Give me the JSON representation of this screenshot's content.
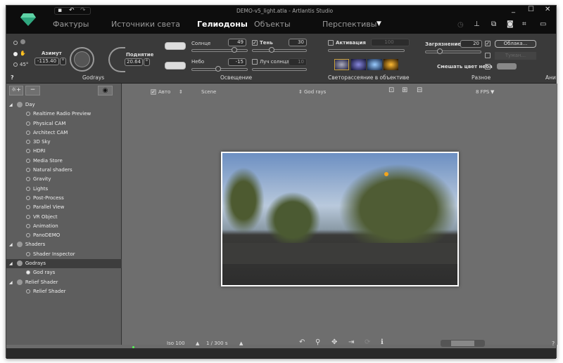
{
  "window": {
    "title": "DEMO-v5_light.atla - Artlantis Studio",
    "minimize": "_",
    "maximize": "☐",
    "close": "✕"
  },
  "tabs": [
    {
      "label": "Фактуры"
    },
    {
      "label": "Источники света"
    },
    {
      "label": "Гелиодоны"
    },
    {
      "label": "Объекты"
    },
    {
      "label": "Перспективы"
    }
  ],
  "tabs_dropdown": "▼",
  "ribbon": {
    "godrays": {
      "group": "Godrays",
      "azimuth_label": "Азимут",
      "azimuth_value": "-115.40",
      "elevation_label": "Поднятие",
      "elevation_value": "20.64",
      "deg": "°",
      "radio_45": "45°",
      "help": "?"
    },
    "lighting": {
      "group": "Освещение",
      "sun_label": "Солнце",
      "sun_value": "49",
      "sky_label": "Небо",
      "sky_value": "-15",
      "shadow_label": "Тень",
      "shadow_value": "30",
      "sunray_label": "Луч солнца",
      "sunray_value": "10",
      "sun_fraction": 0.72,
      "sky_fraction": 0.42,
      "shadow_fraction": 0.3
    },
    "lens": {
      "group": "Светорассеяние в объективе",
      "activation_label": "Активация",
      "activation_value": "100"
    },
    "misc": {
      "group": "Разное",
      "pollution_label": "Загрязнение",
      "pollution_value": "20",
      "clouds_button": "Облака...",
      "fog_button": "Туман...",
      "mix_sky_label": "Смешать цвет неба",
      "pollution_fraction": 0.2
    },
    "anim_group": "Ани"
  },
  "left_panel": {
    "tree": [
      {
        "label": "Day",
        "type": "group"
      },
      {
        "label": "Realtime Radio Preview"
      },
      {
        "label": "Physical CAM"
      },
      {
        "label": "Architect CAM"
      },
      {
        "label": "3D Sky"
      },
      {
        "label": "HDRI"
      },
      {
        "label": "Media Store"
      },
      {
        "label": "Natural shaders"
      },
      {
        "label": "Gravity"
      },
      {
        "label": "Lights"
      },
      {
        "label": "Post-Process"
      },
      {
        "label": "Parallel View"
      },
      {
        "label": "VR Object"
      },
      {
        "label": "Animation"
      },
      {
        "label": "PanoDEMO"
      },
      {
        "label": "Shaders",
        "type": "group"
      },
      {
        "label": "Shader Inspector"
      },
      {
        "label": "Godrays",
        "type": "group",
        "selected": true
      },
      {
        "label": "God rays",
        "active": true
      },
      {
        "label": "Relief Shader",
        "type": "group"
      },
      {
        "label": "Relief Shader"
      }
    ]
  },
  "viewport": {
    "auto_label": "Авто",
    "scene_label": "Scene",
    "view_label": "God rays",
    "fps": "8 FPS"
  },
  "statusbar": {
    "iso": "Iso 100",
    "shutter": "1 / 300 s",
    "help": "?"
  }
}
